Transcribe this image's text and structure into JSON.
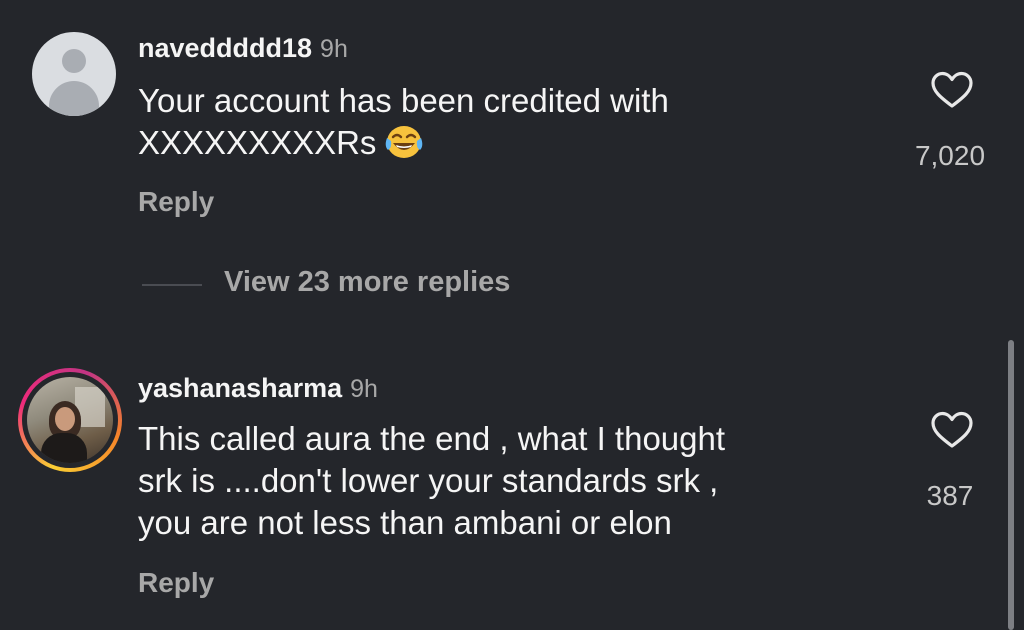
{
  "comments": [
    {
      "username": "naveddddd18",
      "time": "9h",
      "text": "Your account has been credited with\nXXXXXXXXXRs",
      "emoji": "face-with-tears-of-joy-icon",
      "reply_label": "Reply",
      "like_count": "7,020"
    },
    {
      "username": "yashanasharma",
      "time": "9h",
      "text": "This called aura the end , what I thought\nsrk is ....don't lower your standards srk ,\nyou are not less than ambani or elon",
      "reply_label": "Reply",
      "like_count": "387"
    }
  ],
  "thread": {
    "view_replies_label": "View 23 more replies"
  },
  "colors": {
    "background": "#24262b",
    "text_primary": "#f5f5f5",
    "text_secondary": "#a8a8a8",
    "story_ring": [
      "#f9ce34",
      "#ee2a7b",
      "#c13584",
      "#f58529"
    ]
  }
}
